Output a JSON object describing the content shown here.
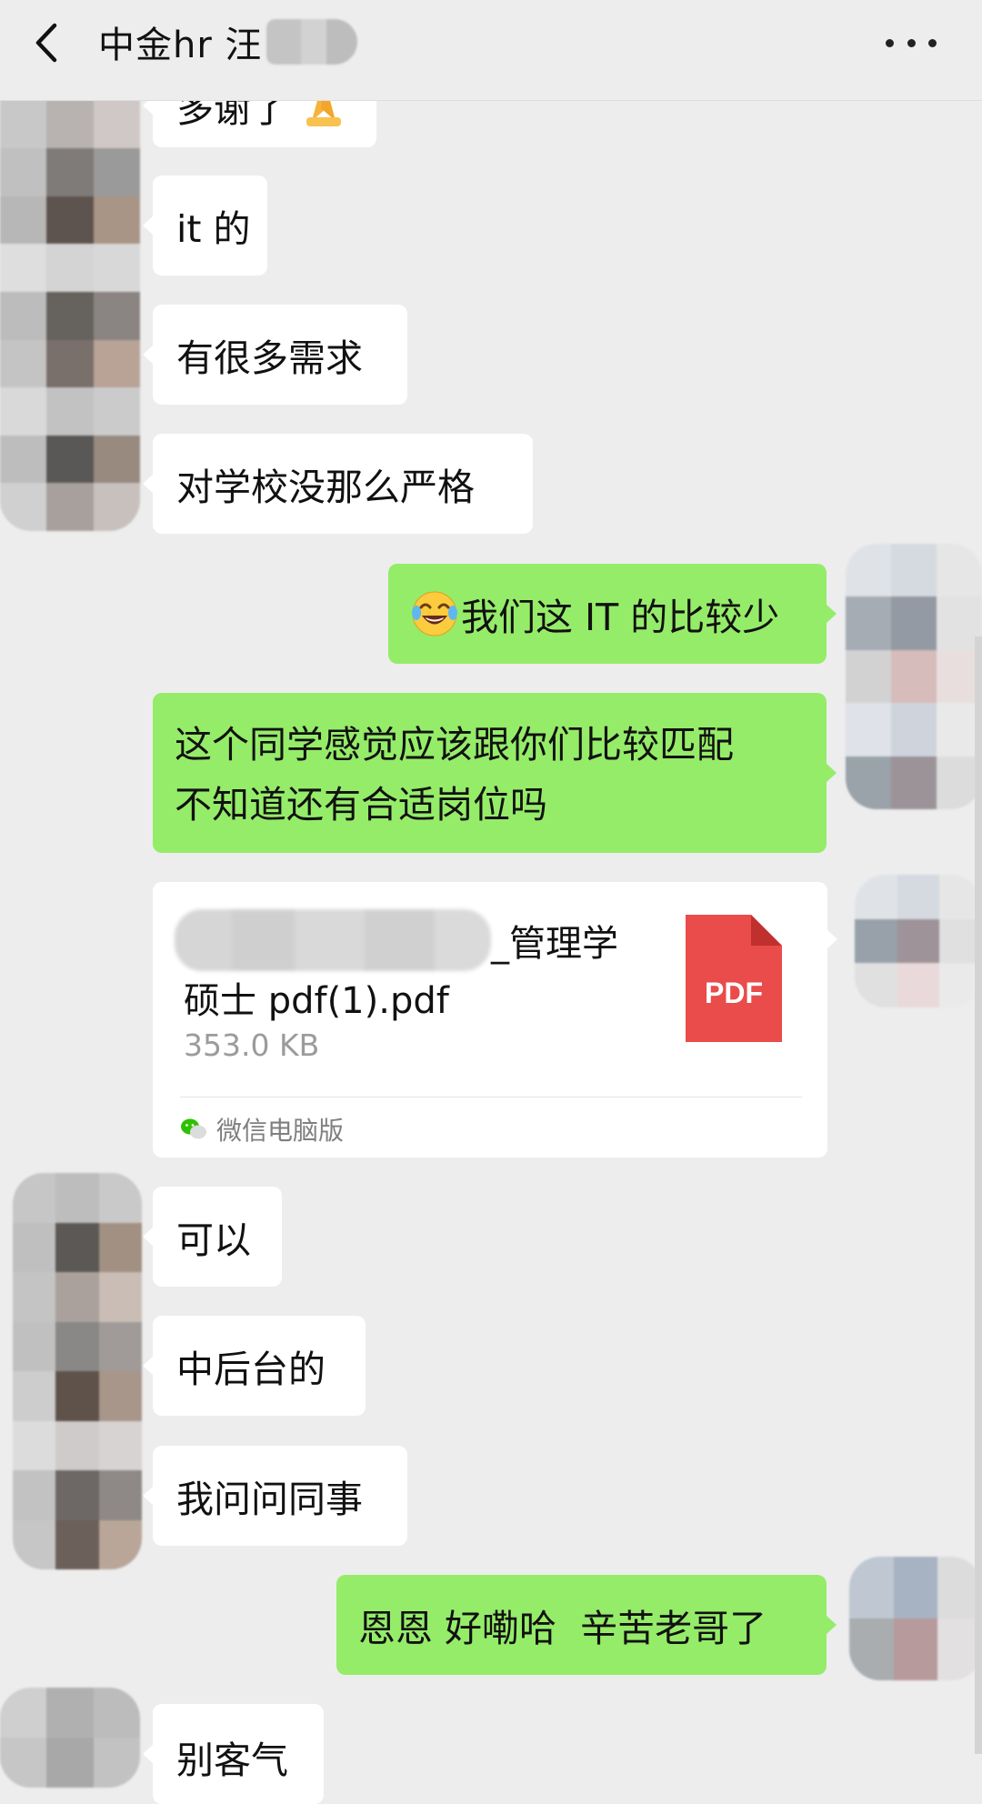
{
  "header": {
    "title": "中金hr 汪",
    "back_icon": "chevron-left-icon",
    "more_icon": "ellipsis-icon"
  },
  "messages": {
    "partial_top": "多谢了",
    "m1": "it 的",
    "m2": "有很多需求",
    "m3": "对学校没那么严格",
    "m4": "我们这 IT 的比较少",
    "m5_line1": "这个同学感觉应该跟你们比较匹配",
    "m5_line2": "不知道还有合适岗位吗",
    "m6": "可以",
    "m7": "中后台的",
    "m8": "我问问同事",
    "m9": "恩恩 好嘞哈  辛苦老哥了",
    "partial_bottom": "别客气"
  },
  "file": {
    "name_suffix": "_管理学",
    "name_line2": "硕士 pdf(1).pdf",
    "size": "353.0 KB",
    "type_label": "PDF",
    "source": "微信电脑版",
    "source_icon": "wechat-icon"
  },
  "colors": {
    "background": "#ededed",
    "outgoing_bubble": "#95ec69",
    "incoming_bubble": "#ffffff",
    "pdf_red": "#e94c4a"
  }
}
